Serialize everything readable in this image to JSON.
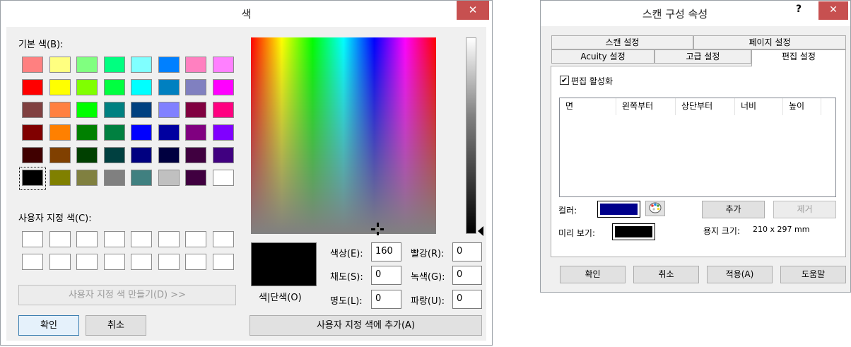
{
  "color_dialog": {
    "title": "색",
    "close_glyph": "✕",
    "basic_colors_label": "기본 색(B):",
    "basic_colors": [
      [
        "#ff8080",
        "#ffff80",
        "#80ff80",
        "#00ff80",
        "#80ffff",
        "#0080ff",
        "#ff80c0",
        "#ff80ff"
      ],
      [
        "#ff0000",
        "#ffff00",
        "#80ff00",
        "#00ff40",
        "#00ffff",
        "#0080c0",
        "#8080c0",
        "#ff00ff"
      ],
      [
        "#804040",
        "#ff8040",
        "#00ff00",
        "#008080",
        "#004080",
        "#8080ff",
        "#800040",
        "#ff0080"
      ],
      [
        "#800000",
        "#ff8000",
        "#008000",
        "#008040",
        "#0000ff",
        "#0000a0",
        "#800080",
        "#8000ff"
      ],
      [
        "#400000",
        "#804000",
        "#004000",
        "#004040",
        "#000080",
        "#000040",
        "#400040",
        "#400080"
      ],
      [
        "#000000",
        "#808000",
        "#808040",
        "#808080",
        "#408080",
        "#c0c0c0",
        "#400040",
        "#ffffff"
      ]
    ],
    "selected_color": "#000000",
    "custom_colors_label": "사용자 지정 색(C):",
    "define_custom_button": "사용자 지정 색 만들기(D) >>",
    "ok_button": "확인",
    "cancel_button": "취소",
    "color_solid_label": "색|단색(O)",
    "hue_label": "색상(E):",
    "hue_value": "160",
    "sat_label": "채도(S):",
    "sat_value": "0",
    "lum_label": "명도(L):",
    "lum_value": "0",
    "red_label": "빨강(R):",
    "red_value": "0",
    "green_label": "녹색(G):",
    "green_value": "0",
    "blue_label": "파랑(U):",
    "blue_value": "0",
    "add_custom_button": "사용자 지정 색에 추가(A)"
  },
  "scan_dialog": {
    "title": "스캔 구성 속성",
    "help_glyph": "?",
    "close_glyph": "✕",
    "tabs_back": [
      "스캔 설정",
      "페이지 설정"
    ],
    "tabs_front": [
      "Acuity 설정",
      "고급 설정",
      "편집 설정"
    ],
    "active_tab": "편집 설정",
    "enable_edit_label": "편집 활성화",
    "enable_edit_checked": "✔",
    "columns": [
      "면",
      "왼쪽부터",
      "상단부터",
      "너비",
      "높이"
    ],
    "color_label": "컬러:",
    "color_value": "#00008b",
    "palette_icon": "palette-icon",
    "add_button": "추가",
    "remove_button": "제거",
    "preview_label": "미리 보기:",
    "preview_color": "#000000",
    "paper_size_label": "용지 크기:",
    "paper_size_value": "210 x 297 mm",
    "ok_button": "확인",
    "cancel_button": "취소",
    "apply_button": "적용(A)",
    "help_button": "도움말"
  }
}
